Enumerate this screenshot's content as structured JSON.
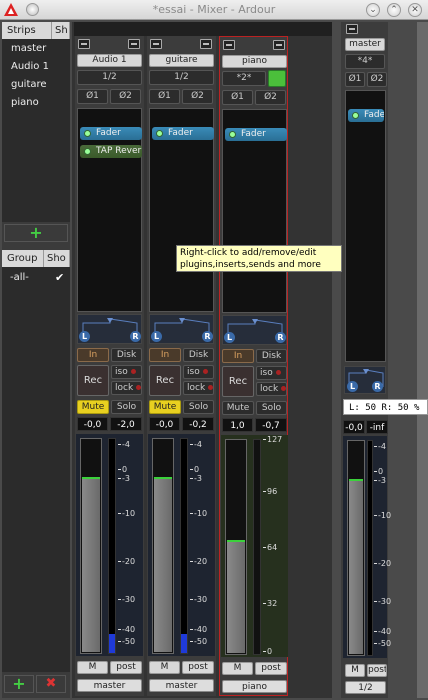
{
  "window": {
    "title": "*essai - Mixer - Ardour"
  },
  "left_panel": {
    "strips_header": "Strips",
    "show_header": "Sh",
    "strips": [
      "master",
      "Audio 1",
      "guitare",
      "piano"
    ],
    "group_header": "Group",
    "group_show_header": "Sho",
    "groups": [
      {
        "name": "-all-",
        "checked": true
      }
    ]
  },
  "tooltip": "Right-click to add/remove/edit plugins,inserts,sends and more",
  "strips": [
    {
      "name": "Audio 1",
      "input": "1/2",
      "phase1": "Ø1",
      "phase2": "Ø2",
      "plugins": [
        "Fader",
        "TAP Reverb"
      ],
      "in": "In",
      "disk": "Disk",
      "rec": "Rec",
      "iso": "iso",
      "lock": "lock",
      "mute": "Mute",
      "solo": "Solo",
      "gain": "-0,0",
      "peak": "-2,0",
      "ticks": [
        "-4",
        "0",
        "-3",
        "-10",
        "-20",
        "-30",
        "-40",
        "-50"
      ],
      "fader_level": 0.82,
      "meter_level": 0.09,
      "m": "M",
      "post": "post",
      "output": "master"
    },
    {
      "name": "guitare",
      "input": "1/2",
      "phase1": "Ø1",
      "phase2": "Ø2",
      "plugins": [
        "Fader"
      ],
      "in": "In",
      "disk": "Disk",
      "rec": "Rec",
      "iso": "iso",
      "lock": "lock",
      "mute": "Mute",
      "solo": "Solo",
      "gain": "-0,0",
      "peak": "-0,2",
      "ticks": [
        "-4",
        "0",
        "-3",
        "-10",
        "-20",
        "-30",
        "-40",
        "-50"
      ],
      "fader_level": 0.82,
      "meter_level": 0.09,
      "m": "M",
      "post": "post",
      "output": "master"
    },
    {
      "name": "piano",
      "input": "*2*",
      "phase1": "Ø1",
      "phase2": "Ø2",
      "plugins": [
        "Fader"
      ],
      "in": "In",
      "disk": "Disk",
      "rec": "Rec",
      "iso": "iso",
      "lock": "lock",
      "mute": "Mute",
      "solo": "Solo",
      "gain": "1,0",
      "peak": "-0,7",
      "ticks": [
        "127",
        "96",
        "64",
        "32",
        "0"
      ],
      "fader_level": 0.53,
      "meter_level": 0.0,
      "m": "M",
      "post": "post",
      "output": "piano"
    }
  ],
  "master": {
    "name": "master",
    "input": "*4*",
    "phase1": "Ø1",
    "phase2": "Ø2",
    "plugins": [
      "Fader"
    ],
    "gain": "-0,0",
    "peak": "-inf",
    "ticks": [
      "-4",
      "0",
      "-3",
      "-10",
      "-20",
      "-30",
      "-40",
      "-50"
    ],
    "fader_level": 0.82,
    "m": "M",
    "post": "post",
    "output": "1/2",
    "pan_tooltip": "L: 50 R: 50 %"
  },
  "colors": {
    "mute_active": "#e8d020",
    "fader_plugin": "#3a8bb8",
    "selected_border": "#b22222"
  }
}
